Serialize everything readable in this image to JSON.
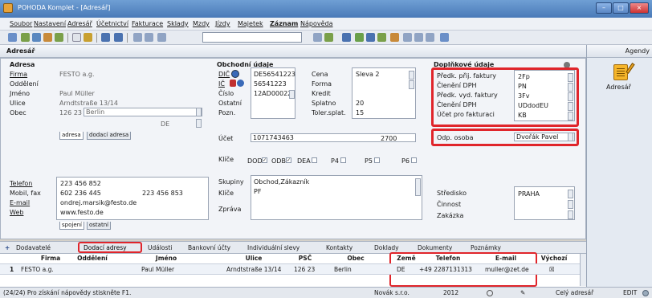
{
  "window": {
    "title": "POHODA Komplet - [Adresář]",
    "min": "–",
    "max": "□",
    "close": "×"
  },
  "menu": [
    "Soubor",
    "Nastavení",
    "Adresář",
    "Účetnictví",
    "Fakturace",
    "Sklady",
    "Mzdy",
    "Jízdy",
    "Majetek",
    "Záznam",
    "Nápověda"
  ],
  "panel_title": "Adresář",
  "agenda": {
    "header": "Agendy",
    "item": "Adresář"
  },
  "adresa": {
    "section": "Adresa",
    "labels": {
      "firma": "Firma",
      "oddeleni": "Oddělení",
      "jmeno": "Jméno",
      "ulice": "Ulice",
      "obec": "Obec"
    },
    "values": {
      "firma": "FESTO a.g.",
      "oddeleni": "",
      "jmeno": "Paul Müller",
      "ulice": "Arndtstraße 13/14",
      "psc": "126 23",
      "obec": "Berlin",
      "zeme": "DE"
    },
    "tabs": [
      "adresa",
      "dodací adresa"
    ]
  },
  "kontakt": {
    "labels": {
      "telefon": "Telefon",
      "mobil": "Mobil, fax",
      "email": "E-mail",
      "web": "Web"
    },
    "values": {
      "telefon": "223 456 852",
      "mobil": "602 236 445",
      "fax": "223 456 853",
      "email": "ondrej.marsik@festo.de",
      "web": "www.festo.de"
    },
    "tabs": [
      "spojení",
      "ostatní"
    ]
  },
  "obchodni": {
    "section": "Obchodní údaje",
    "labels": {
      "dic": "DIČ",
      "ic": "IČ",
      "cislo": "Číslo",
      "ostatni": "Ostatní",
      "pozn": "Pozn.",
      "ucet": "Účet"
    },
    "values": {
      "dic": "DE56541223",
      "ic": "56541223",
      "cislo": "12AD00022",
      "ucet": "1071743463",
      "kod_banky": "2700"
    },
    "right_labels": {
      "cena": "Cena",
      "forma": "Forma",
      "kredit": "Kredit",
      "splatno": "Splatno",
      "toler": "Toler.splat."
    },
    "right_values": {
      "cena": "Sleva 2",
      "splatno": "20",
      "toler": "15"
    }
  },
  "klice": {
    "label": "Klíče",
    "checks": [
      {
        "label": "DOD",
        "checked": true
      },
      {
        "label": "ODB",
        "checked": true
      },
      {
        "label": "DEA",
        "checked": false
      },
      {
        "label": "P4",
        "checked": false
      },
      {
        "label": "P5",
        "checked": false
      },
      {
        "label": "P6",
        "checked": false
      }
    ],
    "skupiny_label": "Skupiny",
    "skupiny": "Obchod,Zákazník",
    "klice_label": "Klíče",
    "klice": "PF",
    "zprava_label": "Zpráva"
  },
  "doplnkove": {
    "section": "Doplňkové údaje",
    "rows": [
      {
        "label": "Předk. přij. faktury",
        "value": "2Fp"
      },
      {
        "label": "Členění DPH",
        "value": "PN"
      },
      {
        "label": "Předk. vyd. faktury",
        "value": "3Fv"
      },
      {
        "label": "Členění DPH",
        "value": "UDdodEU"
      },
      {
        "label": "Účet pro fakturaci",
        "value": "KB"
      }
    ],
    "odp_label": "Odp. osoba",
    "odp_value": "Dvořák Pavel",
    "stredisko_label": "Středisko",
    "stredisko": "PRAHA",
    "cinnost_label": "Činnost",
    "zakazka_label": "Zakázka"
  },
  "bottom_tabs": [
    "Dodavatelé",
    "Dodací adresy",
    "Události",
    "Bankovní účty",
    "Individuální slevy",
    "Kontakty",
    "Doklady",
    "Dokumenty",
    "Poznámky"
  ],
  "grid": {
    "headers": [
      "Firma",
      "Oddělení",
      "Jméno",
      "Ulice",
      "PSČ",
      "Obec",
      "Země",
      "Telefon",
      "E-mail",
      "Výchozí"
    ],
    "row": {
      "num": "1",
      "firma": "FESTO a.g.",
      "oddeleni": "",
      "jmeno": "Paul Müller",
      "ulice": "Arndtstraße 13/14",
      "psc": "126 23",
      "obec": "Berlin",
      "zeme": "DE",
      "telefon": "+49 2287131313",
      "email": "muller@zet.de",
      "vychozi": "☒"
    }
  },
  "status": {
    "help": "(24/24) Pro získání nápovědy stiskněte F1.",
    "company": "Novák s.r.o.",
    "year": "2012",
    "all": "Celý adresář",
    "mode": "EDIT"
  },
  "colors": {
    "highlight": "#e0252b",
    "titlebar": "#4a7ab8"
  }
}
